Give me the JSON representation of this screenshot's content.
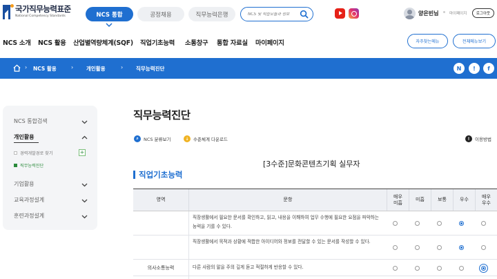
{
  "header": {
    "logo_kr": "국가직무능력표준",
    "logo_en": "National Competency Standards",
    "tabs": [
      "NCS 통합",
      "공정채용",
      "직무능력은행"
    ],
    "search_placeholder": "NCS 및 학습모듈과 정보",
    "user_name": "양은빈님",
    "mypage_label": "마이페이지",
    "logout_label": "로그아웃"
  },
  "nav": {
    "items": [
      "NCS 소개",
      "NCS 활용",
      "산업별역량체계(SQF)",
      "직업기초능력",
      "소통창구",
      "통합 자료실",
      "마이페이지"
    ],
    "quick_menu_label": "자주찾는메뉴",
    "all_menu_label": "전체메뉴보기"
  },
  "breadcrumb": {
    "items": [
      "NCS 활용",
      "개인활용",
      "직무능력진단"
    ],
    "social": [
      "N",
      "!",
      "f"
    ]
  },
  "sidebar": {
    "items": [
      {
        "label": "NCS 통합검색"
      },
      {
        "label": "개인활용"
      },
      {
        "label": "기업활용"
      },
      {
        "label": "교육과정설계"
      },
      {
        "label": "훈련과정설계"
      }
    ],
    "subitems": [
      {
        "label": "경력개발경로 찾기"
      },
      {
        "label": "직무능력진단"
      }
    ]
  },
  "content": {
    "page_title": "직무능력진단",
    "tool_classification": "NCS 분류보기",
    "tool_download": "수준체계 다운로드",
    "usage_label": "이용방법",
    "subject": "[3수준]문화콘텐츠기획 실무자",
    "section_title": "직업기초능력"
  },
  "table": {
    "headers": [
      "영역",
      "문항",
      "매우\n미흡",
      "미흡",
      "보통",
      "우수",
      "매우\n우수"
    ],
    "area": "의사소통능력",
    "rows": [
      {
        "text": "직장생활에서 필요한 문서를 확인하고, 읽고, 내용을 이해하여 업무 수행에 필요한 요점을 파악하는 능력을 기를 수 있다.",
        "selected": 3
      },
      {
        "text": "직장생활에서 목적과 상황에 적합한 아이디어와 정보를 전달할 수 있는 문서를 작성할 수 있다.",
        "selected": 3
      },
      {
        "text": "다른 사람의 말을 주의 깊게 듣고 적절하게 반응할 수 있다.",
        "selected": 4
      }
    ]
  },
  "colors": {
    "primary": "#1f6fd0",
    "sidebar_active": "#2a8a3b",
    "youtube": "#e62117"
  }
}
